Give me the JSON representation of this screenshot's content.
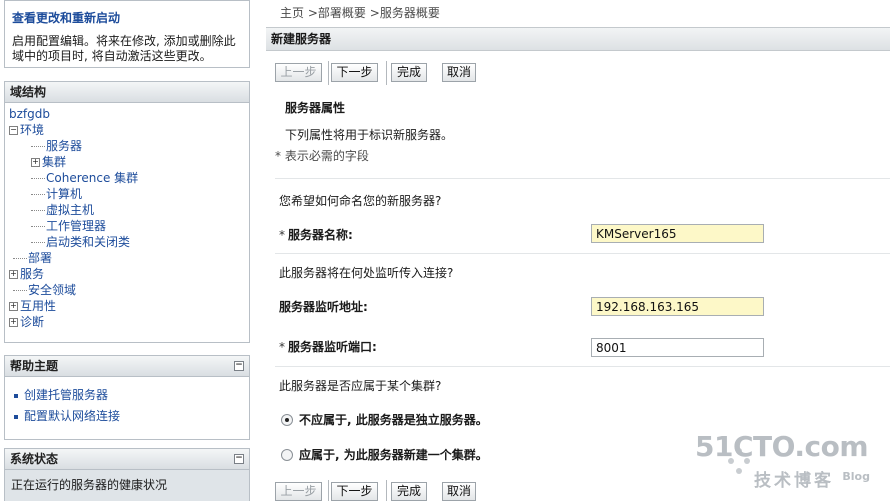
{
  "change_center": {
    "title": "查看更改和重新启动",
    "description": "启用配置编辑。将来在修改, 添加或删除此域中的项目时, 将自动激活这些更改。"
  },
  "domain_structure": {
    "title": "域结构",
    "tree": {
      "root": "bzfgdb",
      "environment": "环境",
      "servers": "服务器",
      "clusters": "集群",
      "coherence_clusters": "Coherence 集群",
      "machines": "计算机",
      "virtual_hosts": "虚拟主机",
      "work_managers": "工作管理器",
      "startup_shutdown": "启动类和关闭类",
      "deployments": "部署",
      "services": "服务",
      "security_realms": "安全领域",
      "interoperability": "互用性",
      "diagnostics": "诊断"
    }
  },
  "help_topics": {
    "title": "帮助主题",
    "items": [
      {
        "label": "创建托管服务器"
      },
      {
        "label": "配置默认网络连接"
      }
    ]
  },
  "system_status": {
    "title": "系统状态",
    "text": "正在运行的服务器的健康状况"
  },
  "breadcrumb": {
    "home": "主页",
    "sep1": ">",
    "deployments": "部署概要",
    "sep2": ">",
    "current": "服务器概要"
  },
  "page": {
    "title": "新建服务器"
  },
  "buttons": {
    "back": "上一步",
    "next": "下一步",
    "finish": "完成",
    "cancel": "取消"
  },
  "form": {
    "section_title": "服务器属性",
    "section_desc": "下列属性将用于标识新服务器。",
    "required_note": "* 表示必需的字段",
    "q_name": "您希望如何命名您的新服务器?",
    "server_name_label": "服务器名称:",
    "server_name_value": "KMServer165",
    "q_listen": "此服务器将在何处监听传入连接?",
    "listen_address_label": "服务器监听地址:",
    "listen_address_value": "192.168.163.165",
    "listen_port_label": "服务器监听端口:",
    "listen_port_value": "8001",
    "q_cluster": "此服务器是否应属于某个集群?",
    "radio_standalone": "不应属于, 此服务器是独立服务器。",
    "radio_new_cluster": "应属于, 为此服务器新建一个集群。",
    "star": "*"
  },
  "colors": {
    "link": "#1d4c9b",
    "highlight_field": "#fdf8c8",
    "panel_border": "#b8bfc6"
  },
  "watermark": {
    "main": "51CTO.com",
    "sub": "技术博客",
    "blog": "Blog"
  }
}
